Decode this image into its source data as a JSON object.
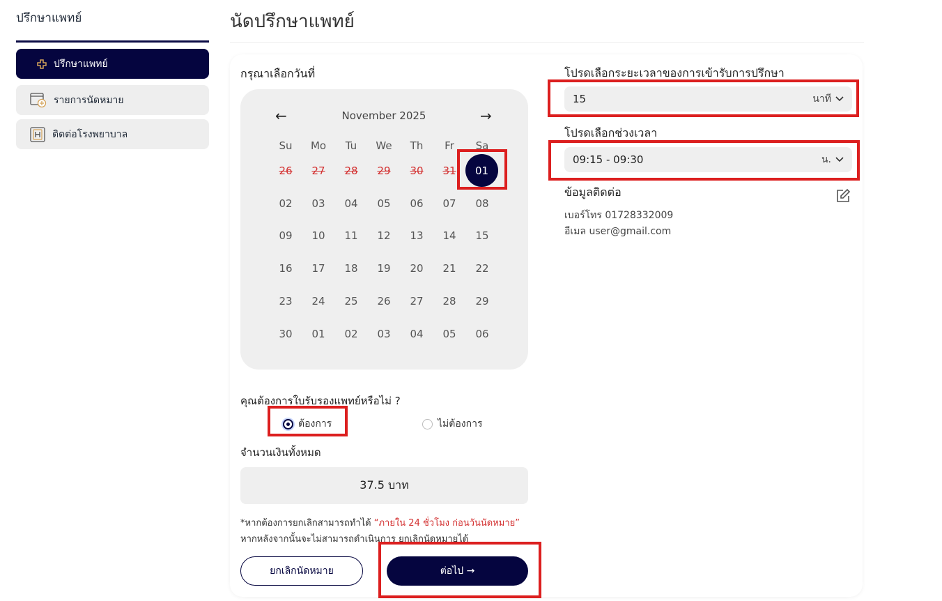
{
  "sidebar": {
    "title": "ปรึกษาแพทย์",
    "items": [
      {
        "label": "ปรึกษาแพทย์",
        "icon": "plus-icon"
      },
      {
        "label": "รายการนัดหมาย",
        "icon": "calendar-add-icon"
      },
      {
        "label": "ติดต่อโรงพยาบาล",
        "icon": "hospital-icon"
      }
    ]
  },
  "page": {
    "title": "นัดปรึกษาแพทย์"
  },
  "calendar": {
    "label": "กรุณาเลือกวันที่",
    "month": "November 2025",
    "prev": "←",
    "next": "→",
    "weekdays": [
      "Su",
      "Mo",
      "Tu",
      "We",
      "Th",
      "Fr",
      "Sa"
    ],
    "rows": [
      [
        "26",
        "27",
        "28",
        "29",
        "30",
        "31",
        "01"
      ],
      [
        "02",
        "03",
        "04",
        "05",
        "06",
        "07",
        "08"
      ],
      [
        "09",
        "10",
        "11",
        "12",
        "13",
        "14",
        "15"
      ],
      [
        "16",
        "17",
        "18",
        "19",
        "20",
        "21",
        "22"
      ],
      [
        "23",
        "24",
        "25",
        "26",
        "27",
        "28",
        "29"
      ],
      [
        "30",
        "01",
        "02",
        "03",
        "04",
        "05",
        "06"
      ]
    ],
    "selected": "01"
  },
  "certificate": {
    "question": "คุณต้องการใบรับรองแพทย์หรือไม่ ?",
    "options": [
      "ต้องการ",
      "ไม่ต้องการ"
    ],
    "selected": "ต้องการ"
  },
  "total": {
    "label": "จำนวนเงินทั้งหมด",
    "value": "37.5 บาท"
  },
  "note": {
    "prefix": "*หากต้องการยกเลิกสามารถทำได้",
    "highlight": "“ภายใน 24 ชั่วโมง ก่อนวันนัดหมาย”",
    "suffix": "หากหลังจากนั้นจะไม่สามารถดำเนินการ ยกเลิกนัดหมายได้"
  },
  "buttons": {
    "cancel": "ยกเลิกนัดหมาย",
    "next": "ต่อไป →"
  },
  "duration": {
    "label": "โปรดเลือกระยะเวลาของการเข้ารับการปรึกษา",
    "value": "15",
    "unit": "นาที"
  },
  "timeslot": {
    "label": "โปรดเลือกช่วงเวลา",
    "value": "09:15 - 09:30",
    "unit": "น."
  },
  "contact": {
    "label": "ข้อมูลติดต่อ",
    "phone": "เบอร์โทร  01728332009",
    "email": "อีเมล  user@gmail.com"
  },
  "colors": {
    "primary": "#05053f",
    "highlight": "#dc1f1f",
    "danger": "#d32f2f"
  }
}
